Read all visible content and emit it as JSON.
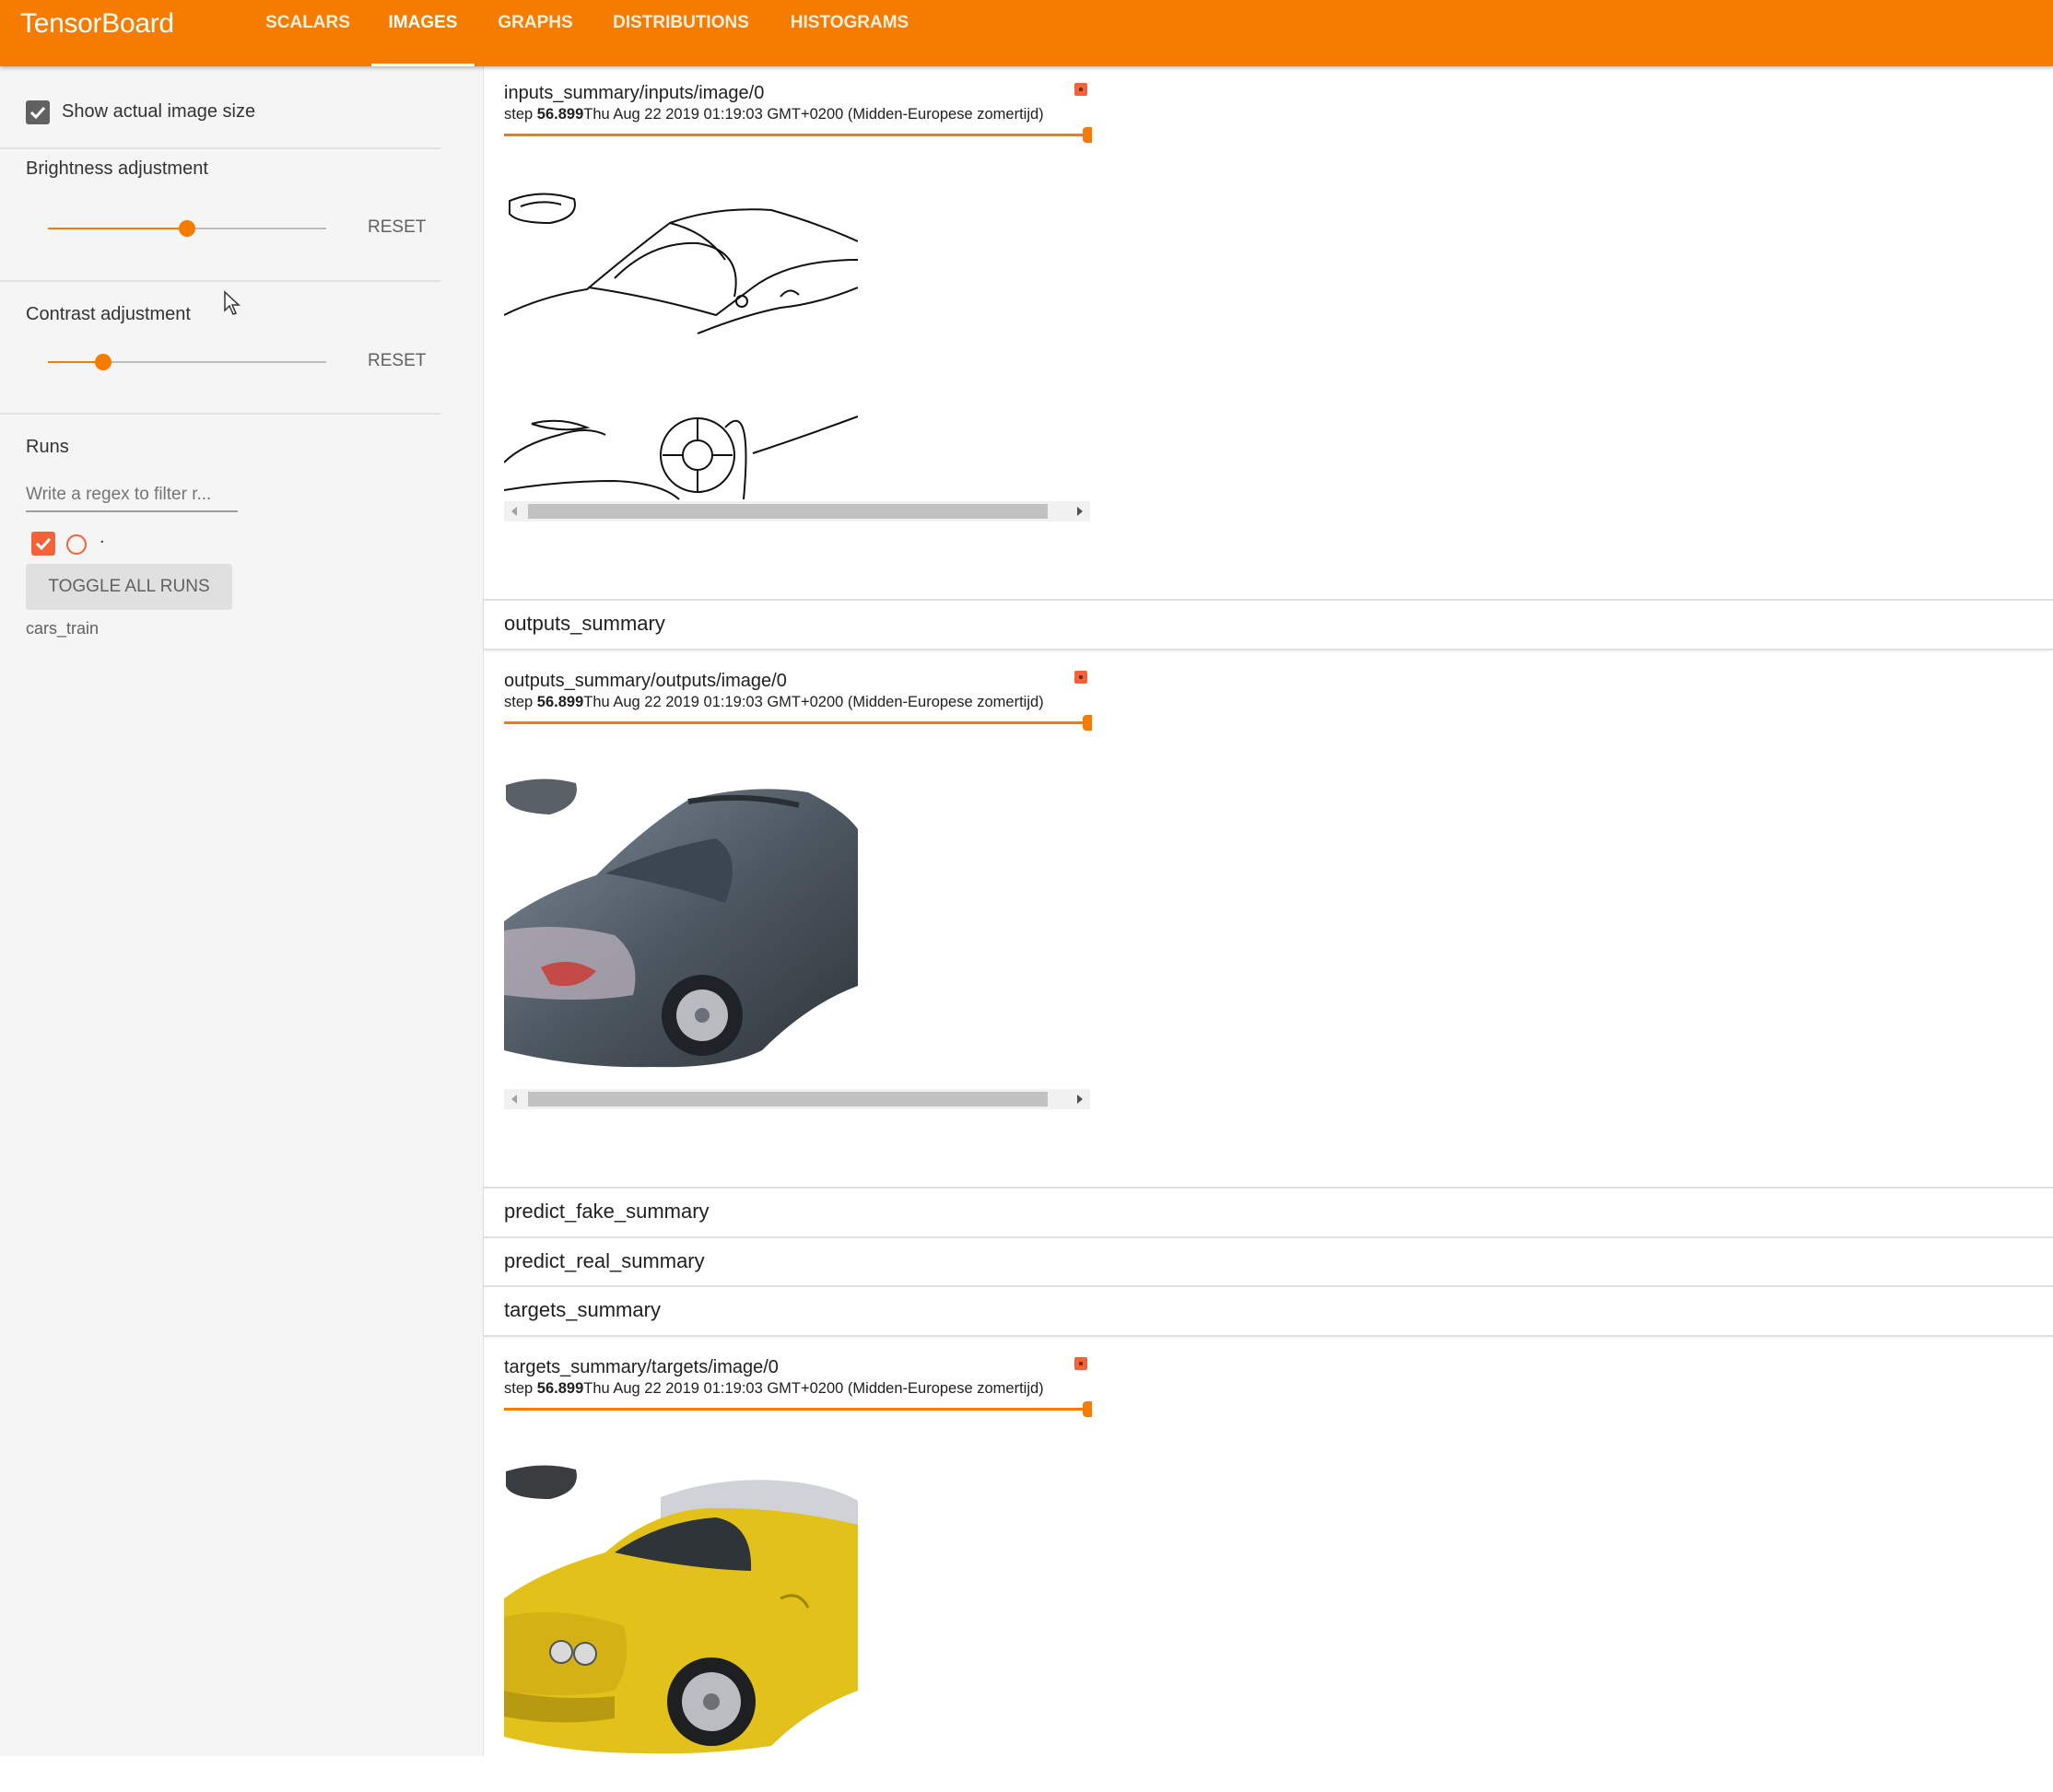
{
  "app": {
    "title": "TensorBoard"
  },
  "nav": {
    "tabs": [
      {
        "label": "SCALARS"
      },
      {
        "label": "IMAGES"
      },
      {
        "label": "GRAPHS"
      },
      {
        "label": "DISTRIBUTIONS"
      },
      {
        "label": "HISTOGRAMS"
      }
    ],
    "active": "IMAGES",
    "accent_color": "#f57c00"
  },
  "sidebar": {
    "show_actual_size": {
      "label": "Show actual image size",
      "checked": true
    },
    "brightness": {
      "label": "Brightness adjustment",
      "reset_label": "RESET",
      "value": 0.5
    },
    "contrast": {
      "label": "Contrast adjustment",
      "reset_label": "RESET",
      "value": 0.2
    },
    "runs": {
      "label": "Runs",
      "filter_placeholder": "Write a regex to filter r...",
      "items": [
        {
          "name": ".",
          "checked": true,
          "color": "#f4623a"
        }
      ],
      "toggle_label": "TOGGLE ALL RUNS",
      "run_name": "cars_train"
    }
  },
  "main": {
    "cards": [
      {
        "title": "inputs_summary/inputs/image/0",
        "step_label": "step",
        "step_value": "56.899",
        "timestamp": "Thu Aug 22 2019 01:19:03 GMT+0200 (Midden-Europese zomertijd)",
        "image": "car-edges-sketch"
      },
      {
        "title": "outputs_summary/outputs/image/0",
        "step_label": "step",
        "step_value": "56.899",
        "timestamp": "Thu Aug 22 2019 01:19:03 GMT+0200 (Midden-Europese zomertijd)",
        "image": "car-generated-gray"
      },
      {
        "title": "targets_summary/targets/image/0",
        "step_label": "step",
        "step_value": "56.899",
        "timestamp": "Thu Aug 22 2019 01:19:03 GMT+0200 (Midden-Europese zomertijd)",
        "image": "car-yellow-photo"
      }
    ],
    "groups": [
      {
        "name": "outputs_summary"
      },
      {
        "name": "predict_fake_summary"
      },
      {
        "name": "predict_real_summary"
      },
      {
        "name": "targets_summary"
      }
    ]
  }
}
